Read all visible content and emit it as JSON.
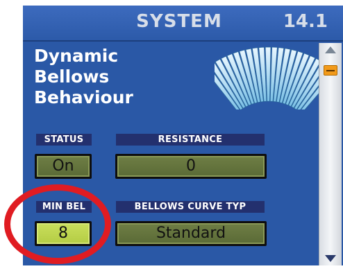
{
  "header": {
    "title": "SYSTEM",
    "number": "14.1"
  },
  "page": {
    "title_lines": [
      "Dynamic",
      "Bellows",
      "Behaviour"
    ]
  },
  "params": {
    "status": {
      "label": "STATUS",
      "value": "On"
    },
    "resistance": {
      "label": "RESISTANCE",
      "value": "0"
    },
    "min_bel": {
      "label": "MIN BEL",
      "value": "8"
    },
    "bellows_curve": {
      "label": "BELLOWS CURVE TYP",
      "value": "Standard"
    }
  },
  "icons": {
    "fan": "bellows-icon",
    "up": "arrow-up-icon",
    "down": "arrow-down-icon"
  },
  "colors": {
    "screen_bg": "#2a58a6",
    "label_bg": "#23306e",
    "field_inactive": "#6f7e45",
    "field_active": "#c9df5c",
    "scroll_thumb": "#f29a1a",
    "highlight_ring": "#e01c22"
  }
}
